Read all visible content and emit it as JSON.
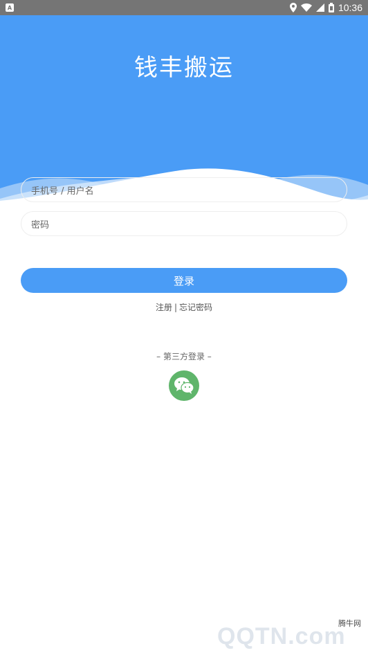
{
  "status_bar": {
    "time": "10:36",
    "icons": [
      "notification-icon",
      "location-icon",
      "wifi-icon",
      "signal-icon",
      "battery-icon"
    ]
  },
  "header": {
    "title": "钱丰搬运",
    "background_color": "#4a9cf6"
  },
  "form": {
    "username_placeholder": "手机号 / 用户名",
    "password_placeholder": "密码",
    "login_label": "登录"
  },
  "links": {
    "register": "注册",
    "separator": "|",
    "forgot_password": "忘记密码"
  },
  "third_party": {
    "label": "– 第三方登录 –",
    "wechat_icon": "wechat-icon",
    "wechat_color": "#5fb56b"
  },
  "watermark": {
    "text": "腾牛网",
    "logo": "QQTN.com"
  }
}
